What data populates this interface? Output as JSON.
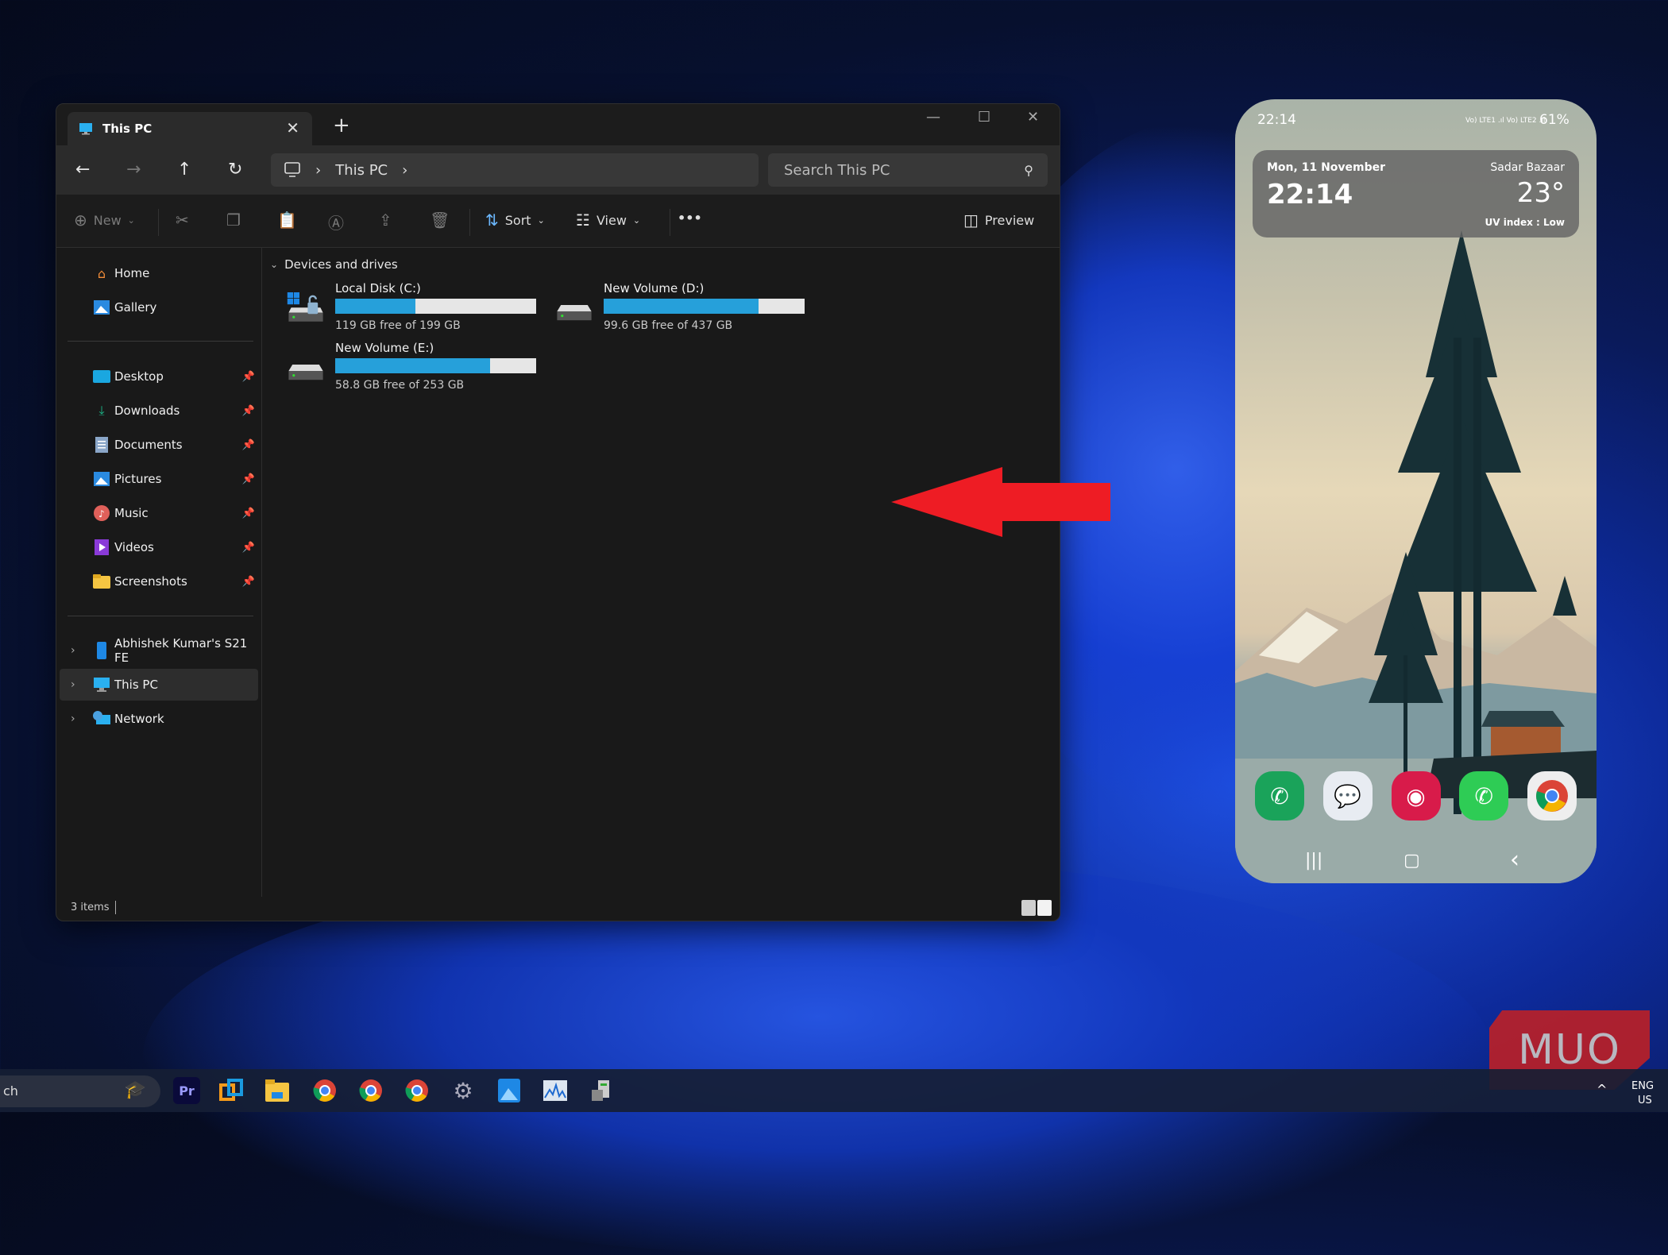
{
  "explorer": {
    "tab_title": "This PC",
    "new_tab": "+",
    "breadcrumb": [
      "This PC"
    ],
    "search_placeholder": "Search This PC",
    "toolbar": {
      "new_label": "New",
      "sort_label": "Sort",
      "view_label": "View",
      "more_label": "•••",
      "preview_label": "Preview"
    },
    "sidebar": {
      "quick": [
        {
          "label": "Home",
          "icon": "home-icon"
        },
        {
          "label": "Gallery",
          "icon": "gallery-icon"
        }
      ],
      "pinned": [
        {
          "label": "Desktop",
          "icon": "desktop-folder-icon"
        },
        {
          "label": "Downloads",
          "icon": "download-icon"
        },
        {
          "label": "Documents",
          "icon": "documents-icon"
        },
        {
          "label": "Pictures",
          "icon": "pictures-icon"
        },
        {
          "label": "Music",
          "icon": "music-icon"
        },
        {
          "label": "Videos",
          "icon": "videos-icon"
        },
        {
          "label": "Screenshots",
          "icon": "folder-icon"
        }
      ],
      "tree": [
        {
          "label": "Abhishek Kumar's S21 FE",
          "icon": "phone-icon",
          "selected": false
        },
        {
          "label": "This PC",
          "icon": "pc-icon",
          "selected": true
        },
        {
          "label": "Network",
          "icon": "network-icon",
          "selected": false
        }
      ]
    },
    "group_header": "Devices and drives",
    "drives": [
      {
        "name": "Local Disk (C:)",
        "free": "119 GB free of 199 GB",
        "used_fraction": 0.4,
        "system": true
      },
      {
        "name": "New Volume (D:)",
        "free": "99.6 GB free of 437 GB",
        "used_fraction": 0.77,
        "system": false
      },
      {
        "name": "New Volume (E:)",
        "free": "58.8 GB free of 253 GB",
        "used_fraction": 0.77,
        "system": false
      }
    ],
    "status": "3 items",
    "colors": {
      "bar_fill": "#26a0da",
      "bar_bg": "#e6e6e6"
    }
  },
  "annotation": {
    "arrow_color": "#ee1c24",
    "direction": "left"
  },
  "phone": {
    "status_time": "22:14",
    "status_icons": "Vo) LTE1 .ıl Vo) LTE2 .ıl",
    "battery": "61%",
    "widget": {
      "date": "Mon, 11 November",
      "time": "22:14",
      "location": "Sadar Bazaar",
      "temperature": "23°",
      "uv": "UV index : Low"
    },
    "dock": [
      {
        "name": "Phone",
        "color": "#1aa35a"
      },
      {
        "name": "Messages",
        "color": "#e8ecf2"
      },
      {
        "name": "Camera",
        "color": "#d81b4a"
      },
      {
        "name": "WhatsApp",
        "color": "#2ecc55"
      },
      {
        "name": "Chrome",
        "color": "#eeeeee"
      }
    ],
    "nav": {
      "recents": "|||",
      "home": "▢",
      "back": "‹"
    }
  },
  "taskbar": {
    "search_text": "ch",
    "apps": [
      {
        "name": "Premiere Pro",
        "label": "Pr"
      },
      {
        "name": "VMware",
        "label": ""
      },
      {
        "name": "File Explorer",
        "label": ""
      },
      {
        "name": "Chrome profile 1",
        "label": ""
      },
      {
        "name": "Chrome profile 2",
        "label": ""
      },
      {
        "name": "Chrome profile 3",
        "label": ""
      },
      {
        "name": "Settings",
        "label": ""
      },
      {
        "name": "Photos",
        "label": ""
      },
      {
        "name": "Resource Monitor",
        "label": ""
      },
      {
        "name": "Device Manager",
        "label": ""
      }
    ],
    "tray": {
      "lang": "ENG",
      "region": "US",
      "chevron": "^"
    }
  },
  "watermark": "MUO"
}
